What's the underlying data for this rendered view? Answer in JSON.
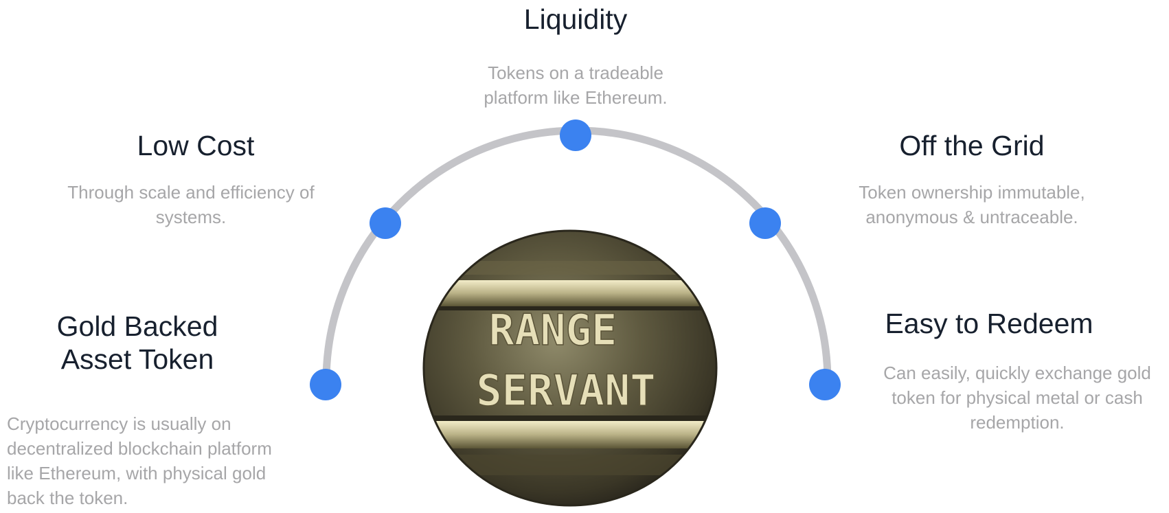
{
  "features": [
    {
      "title": "Liquidity",
      "description": "Tokens on a tradeable platform like Ethereum."
    },
    {
      "title": "Low Cost",
      "description": "Through scale and efficiency of systems."
    },
    {
      "title": "Off the Grid",
      "description": "Token ownership immutable, anonymous & untraceable."
    },
    {
      "title": "Gold Backed Asset Token",
      "description": "Cryptocurrency is usually on decentralized blockchain platform like Ethereum, with physical gold back the token."
    },
    {
      "title": "Easy to Redeem",
      "description": "Can easily, quickly exchange gold token for physical metal or cash redemption."
    }
  ],
  "coin": {
    "line1": "RANGE",
    "line2": "SERVANT"
  },
  "colors": {
    "arc": "#c4c4c8",
    "node": "#3b82f0",
    "title": "#17202e",
    "description": "#a6a6a8"
  }
}
